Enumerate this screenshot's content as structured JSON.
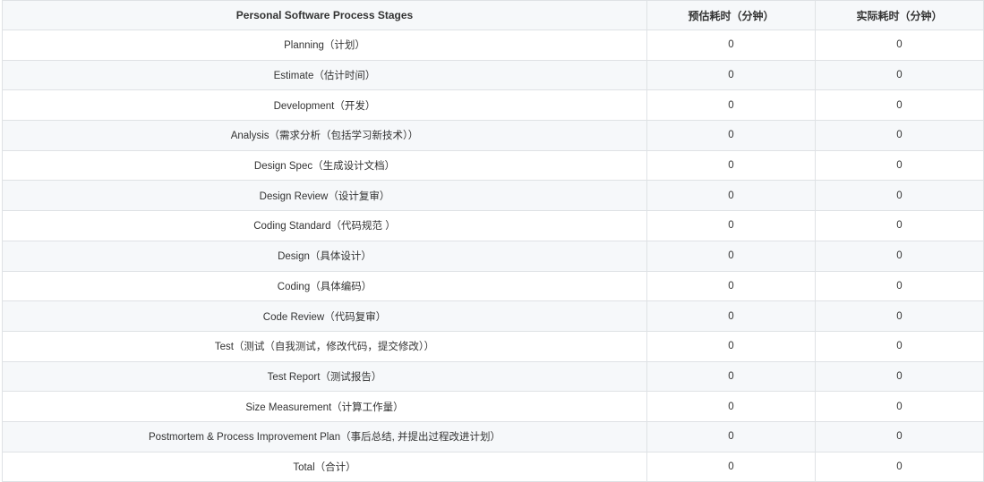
{
  "table": {
    "headers": [
      "Personal Software Process Stages",
      "预估耗时（分钟）",
      "实际耗时（分钟）"
    ],
    "rows": [
      {
        "stage": "Planning（计划）",
        "estimated": "0",
        "actual": "0"
      },
      {
        "stage": "Estimate（估计时间）",
        "estimated": "0",
        "actual": "0"
      },
      {
        "stage": "Development（开发）",
        "estimated": "0",
        "actual": "0"
      },
      {
        "stage": "Analysis（需求分析（包括学习新技术））",
        "estimated": "0",
        "actual": "0"
      },
      {
        "stage": "Design Spec（生成设计文档）",
        "estimated": "0",
        "actual": "0"
      },
      {
        "stage": "Design Review（设计复审）",
        "estimated": "0",
        "actual": "0"
      },
      {
        "stage": "Coding Standard（代码规范 ）",
        "estimated": "0",
        "actual": "0"
      },
      {
        "stage": "Design（具体设计）",
        "estimated": "0",
        "actual": "0"
      },
      {
        "stage": "Coding（具体编码）",
        "estimated": "0",
        "actual": "0"
      },
      {
        "stage": "Code Review（代码复审）",
        "estimated": "0",
        "actual": "0"
      },
      {
        "stage": "Test（测试（自我测试，修改代码，提交修改））",
        "estimated": "0",
        "actual": "0"
      },
      {
        "stage": "Test Report（测试报告）",
        "estimated": "0",
        "actual": "0"
      },
      {
        "stage": "Size Measurement（计算工作量）",
        "estimated": "0",
        "actual": "0"
      },
      {
        "stage": "Postmortem & Process Improvement Plan（事后总结, 并提出过程改进计划）",
        "estimated": "0",
        "actual": "0"
      },
      {
        "stage": "Total（合计）",
        "estimated": "0",
        "actual": "0"
      }
    ]
  }
}
